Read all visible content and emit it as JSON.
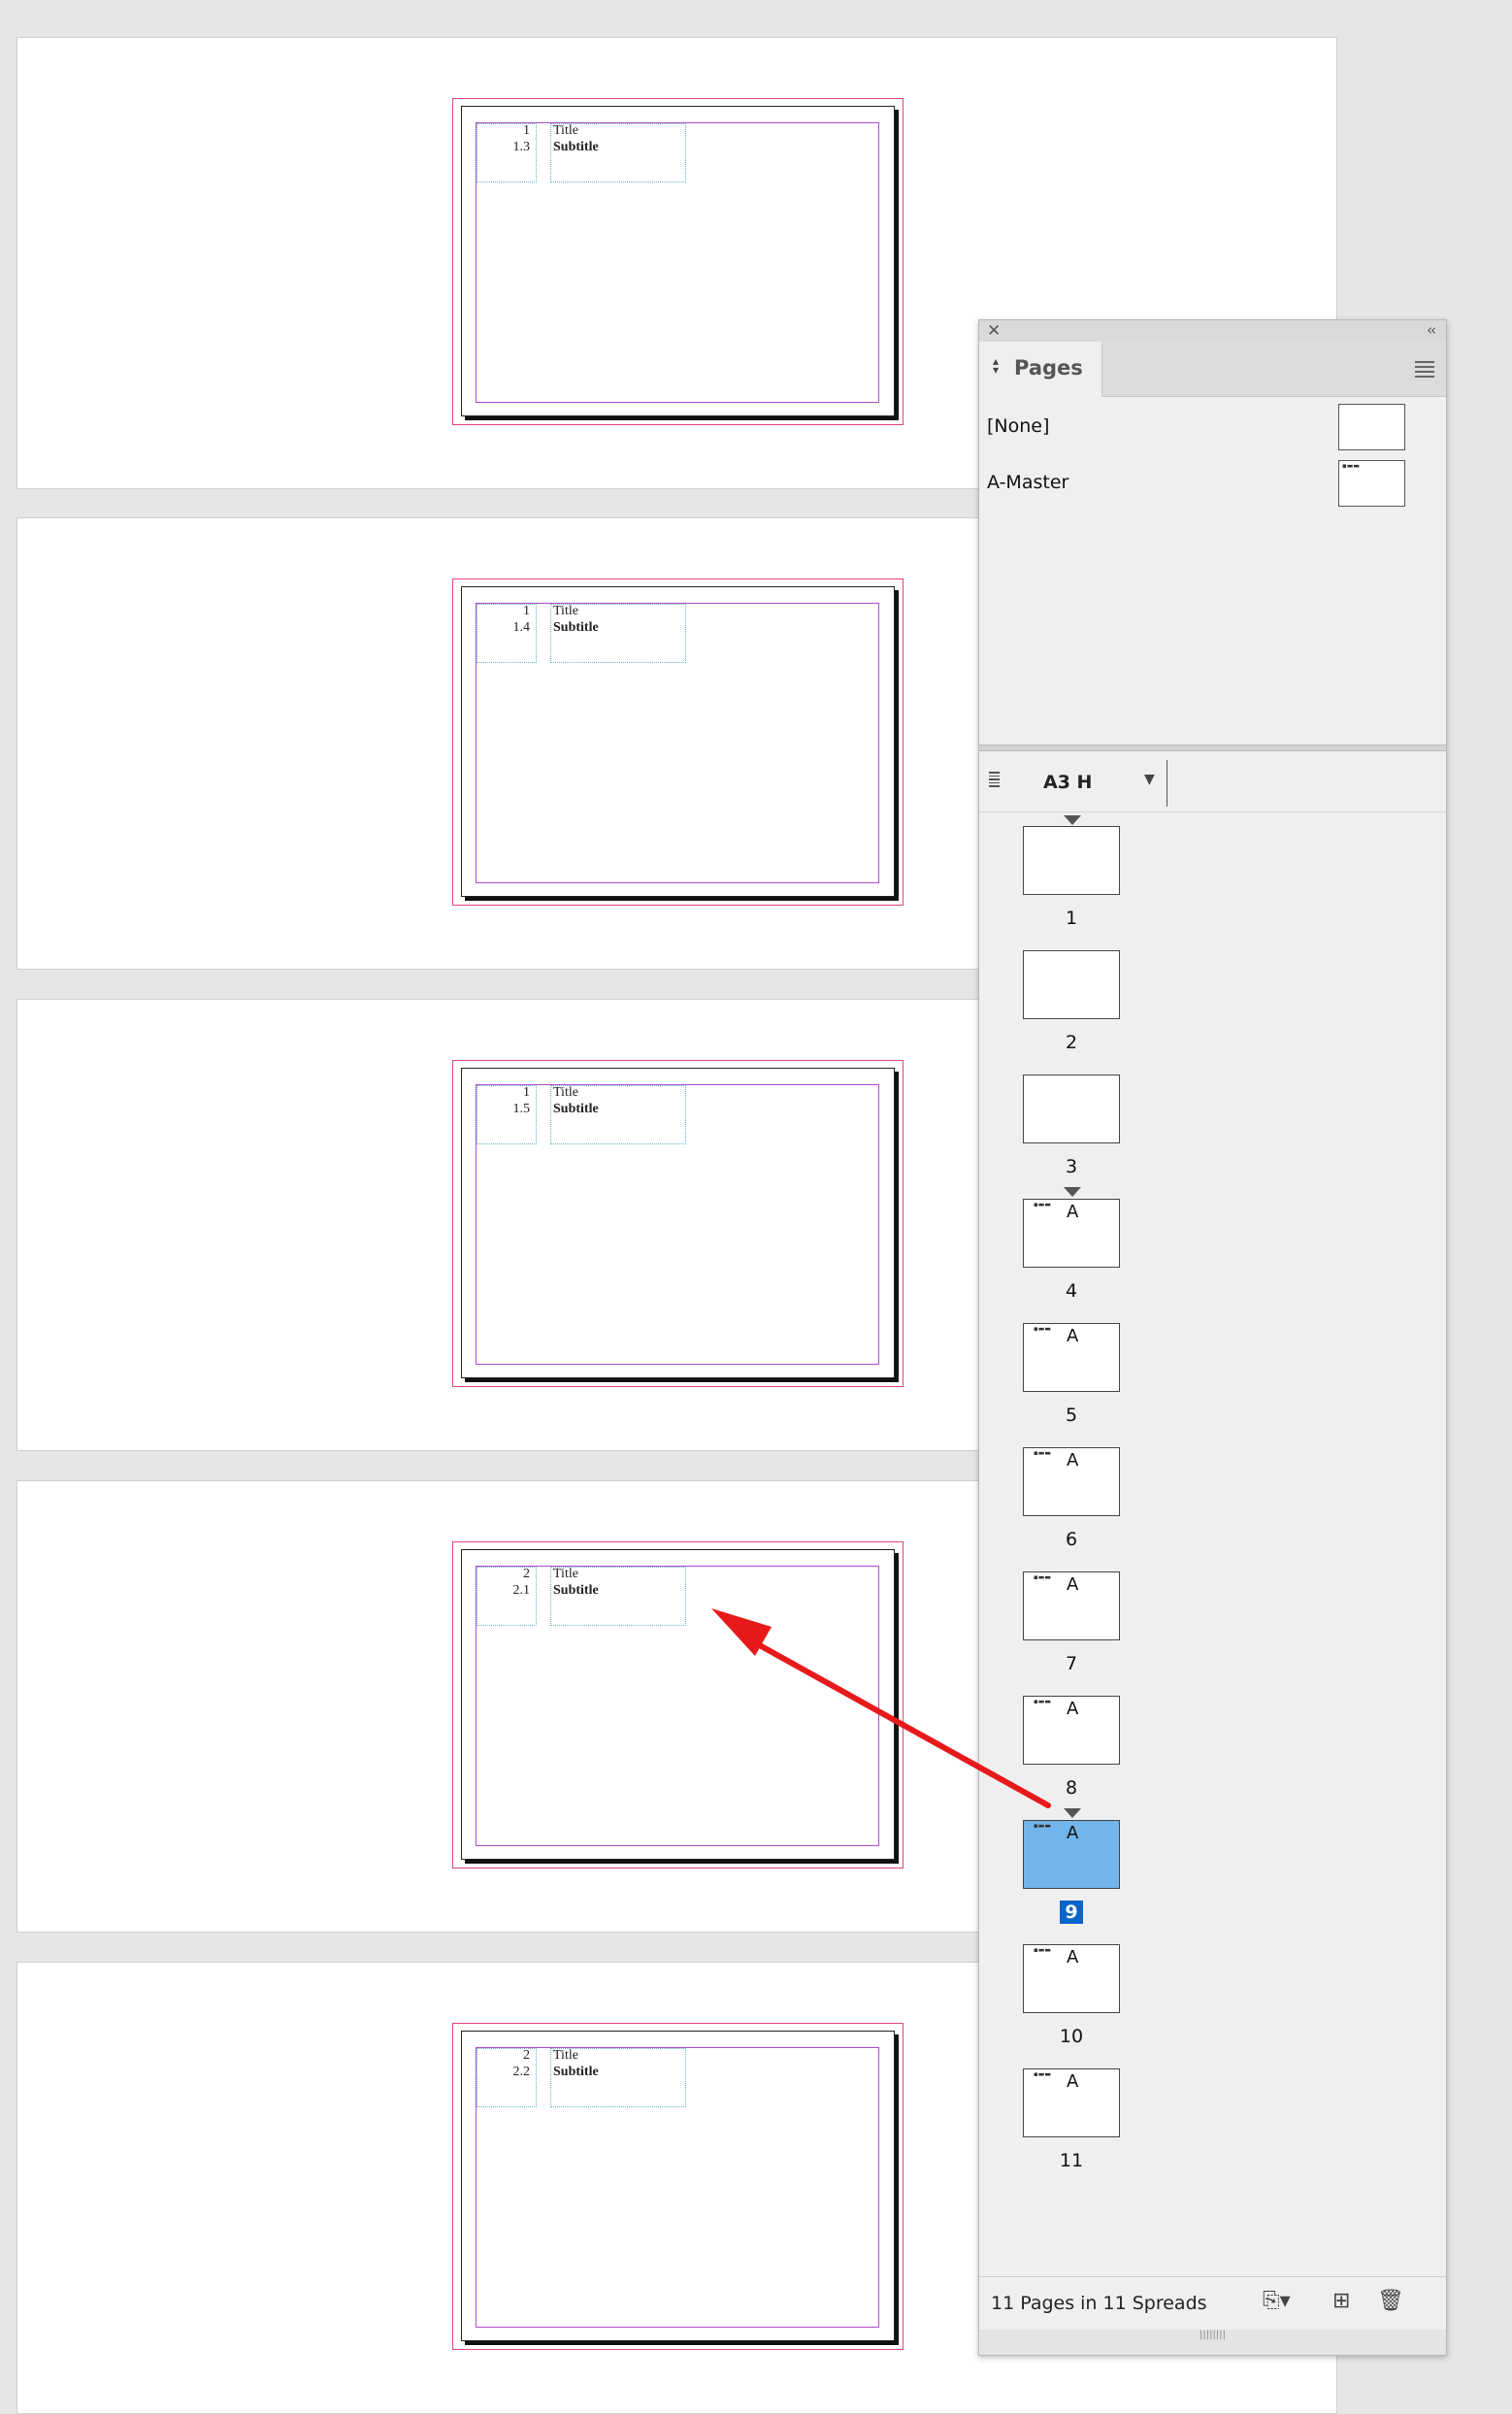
{
  "spreads": [
    {
      "chapter": "1",
      "section": "1.3",
      "title": "Title",
      "subtitle": "Subtitle"
    },
    {
      "chapter": "1",
      "section": "1.4",
      "title": "Title",
      "subtitle": "Subtitle"
    },
    {
      "chapter": "1",
      "section": "1.5",
      "title": "Title",
      "subtitle": "Subtitle"
    },
    {
      "chapter": "2",
      "section": "2.1",
      "title": "Title",
      "subtitle": "Subtitle"
    },
    {
      "chapter": "2",
      "section": "2.2",
      "title": "Title",
      "subtitle": "Subtitle"
    }
  ],
  "panel": {
    "tab_label": "Pages",
    "masters": [
      {
        "label": "[None]"
      },
      {
        "label": "A-Master"
      }
    ],
    "page_size": "A3 H",
    "pages": [
      {
        "label": "1",
        "master": ""
      },
      {
        "label": "2",
        "master": ""
      },
      {
        "label": "3",
        "master": ""
      },
      {
        "label": "4",
        "master": "A"
      },
      {
        "label": "5",
        "master": "A"
      },
      {
        "label": "6",
        "master": "A"
      },
      {
        "label": "7",
        "master": "A"
      },
      {
        "label": "8",
        "master": "A"
      },
      {
        "label": "9",
        "master": "A",
        "selected": true
      },
      {
        "label": "10",
        "master": "A"
      },
      {
        "label": "11",
        "master": "A"
      }
    ],
    "status": "11 Pages in 11 Spreads"
  },
  "annotation": {
    "arrow_color": "#e8191a"
  },
  "colors": {
    "selected_thumb": "#72b4ec",
    "selected_label": "#0a64c8",
    "margin_guide": "#b04bd0",
    "bleed": "#e0457e",
    "text_frame": "#62b7c8"
  }
}
